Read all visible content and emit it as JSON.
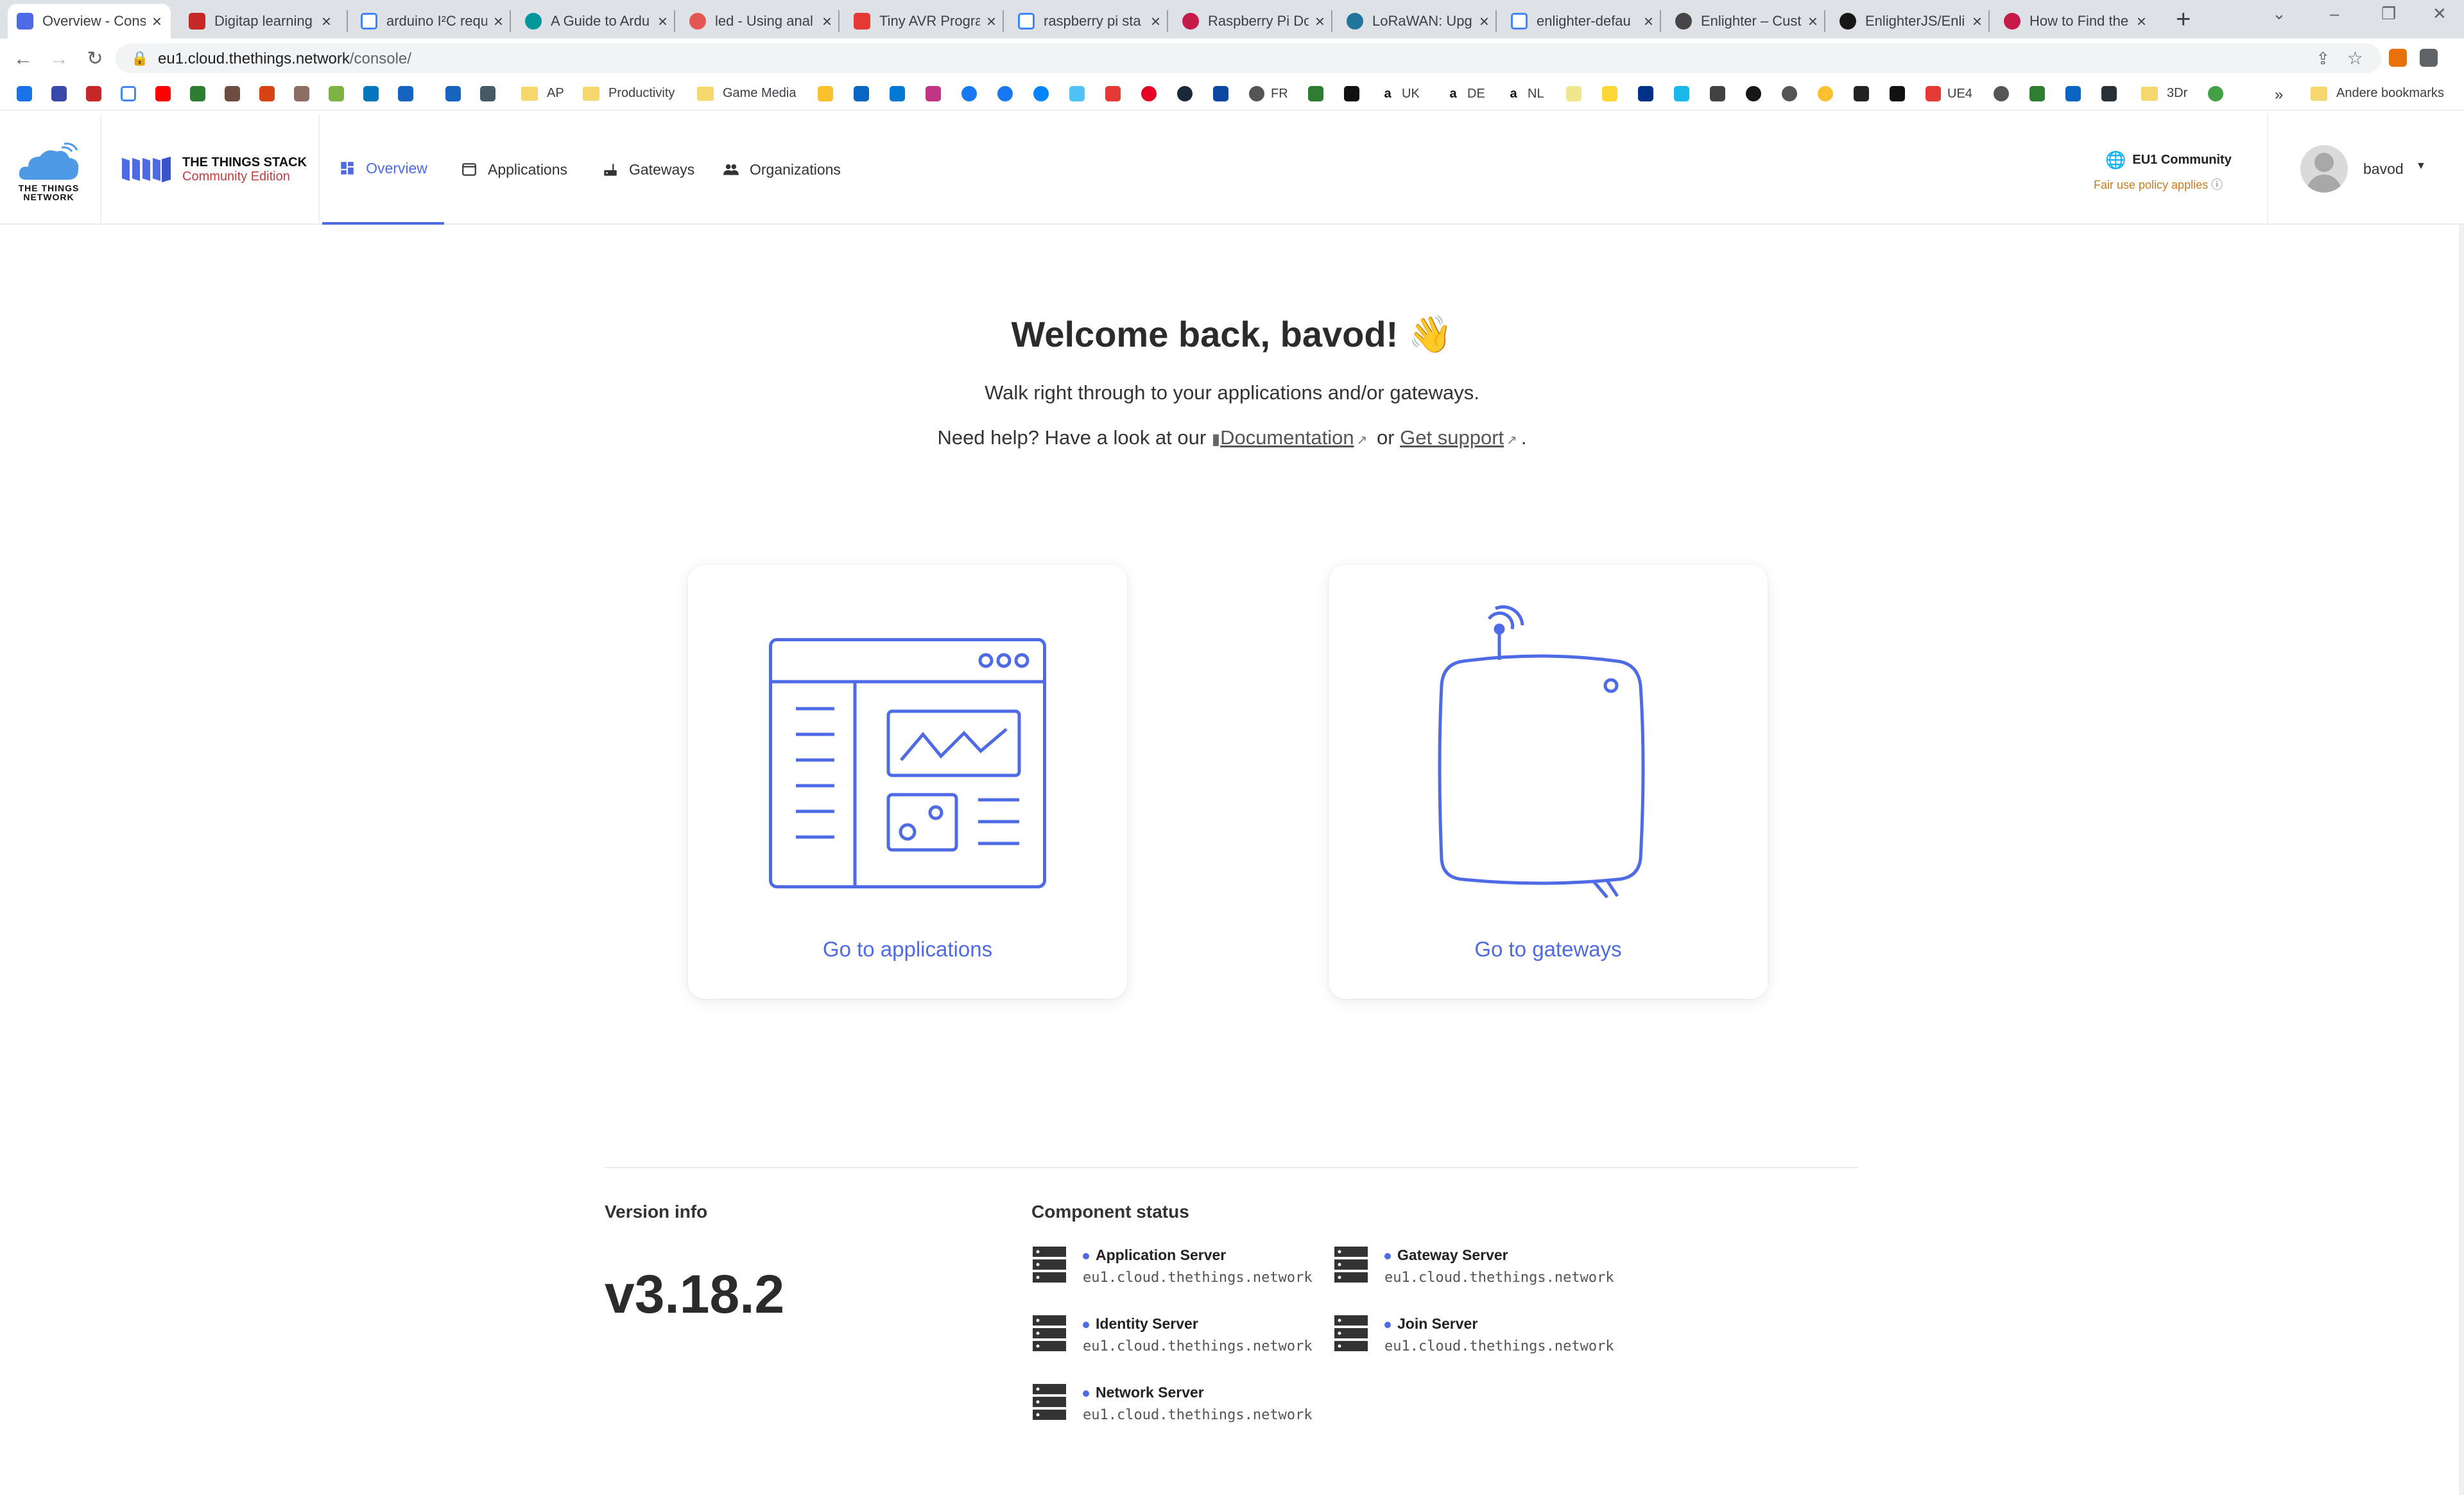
{
  "browser": {
    "tabs": [
      {
        "title": "Overview - Console",
        "icon": "ttn-stack-icon",
        "active": true
      },
      {
        "title": "Digitap learning",
        "icon": "ap-icon"
      },
      {
        "title": "arduino I²C requ",
        "icon": "google-icon"
      },
      {
        "title": "A Guide to Ardu",
        "icon": "arduino-icon"
      },
      {
        "title": "led - Using anal",
        "icon": "stack-exchange-icon"
      },
      {
        "title": "Tiny AVR Progra",
        "icon": "sparkfun-icon"
      },
      {
        "title": "raspberry pi sta",
        "icon": "google-icon"
      },
      {
        "title": "Raspberry Pi Do",
        "icon": "raspberry-icon"
      },
      {
        "title": "LoRaWAN: Upg",
        "icon": "wordpress-icon"
      },
      {
        "title": "enlighter-defau",
        "icon": "google-icon"
      },
      {
        "title": "Enlighter – Cust",
        "icon": "wordpress-icon"
      },
      {
        "title": "EnlighterJS/Enli",
        "icon": "github-icon"
      },
      {
        "title": "How to Find the",
        "icon": "raspberry-icon"
      }
    ],
    "url_host": "eu1.cloud.thethings.network",
    "url_path": "/console/",
    "bookmarks": [
      {
        "label": "AP"
      },
      {
        "label": "Productivity",
        "folder": true
      },
      {
        "label": "Game Media",
        "folder": true
      },
      {
        "label": "FR"
      },
      {
        "label": "UK"
      },
      {
        "label": "DE"
      },
      {
        "label": "NL"
      },
      {
        "label": "UE4"
      },
      {
        "label": "3Dr",
        "folder": true
      }
    ],
    "overflow": "»",
    "other_bookmarks": "Andere bookmarks"
  },
  "header": {
    "ttn_logo_text_1": "THE THINGS",
    "ttn_logo_text_2": "NETWORK",
    "stack_title": "THE THINGS STACK",
    "stack_subtitle": "Community Edition",
    "nav": [
      {
        "label": "Overview",
        "icon": "dashboard-icon",
        "active": true
      },
      {
        "label": "Applications",
        "icon": "window-icon"
      },
      {
        "label": "Gateways",
        "icon": "router-icon"
      },
      {
        "label": "Organizations",
        "icon": "people-icon"
      }
    ],
    "region": "EU1 Community",
    "fair_use": "Fair use policy applies",
    "username": "bavod"
  },
  "main": {
    "welcome": "Welcome back, bavod! 👋",
    "subtitle": "Walk right through to your applications and/or gateways.",
    "help_prefix": "Need help? Have a look at our",
    "doc_link": "Documentation",
    "help_or": "or",
    "support_link": "Get support",
    "help_suffix": ".",
    "cards": [
      {
        "label": "Go to applications"
      },
      {
        "label": "Go to gateways"
      }
    ]
  },
  "footer": {
    "version_title": "Version info",
    "version": "v3.18.2",
    "component_title": "Component status",
    "components": [
      {
        "name": "Application Server",
        "host": "eu1.cloud.thethings.network"
      },
      {
        "name": "Gateway Server",
        "host": "eu1.cloud.thethings.network"
      },
      {
        "name": "Identity Server",
        "host": "eu1.cloud.thethings.network"
      },
      {
        "name": "Join Server",
        "host": "eu1.cloud.thethings.network"
      },
      {
        "name": "Network Server",
        "host": "eu1.cloud.thethings.network"
      }
    ]
  },
  "colors": {
    "accent": "#4f6ae5",
    "brand_red": "#c43c3c",
    "fair_use": "#c87c22"
  }
}
